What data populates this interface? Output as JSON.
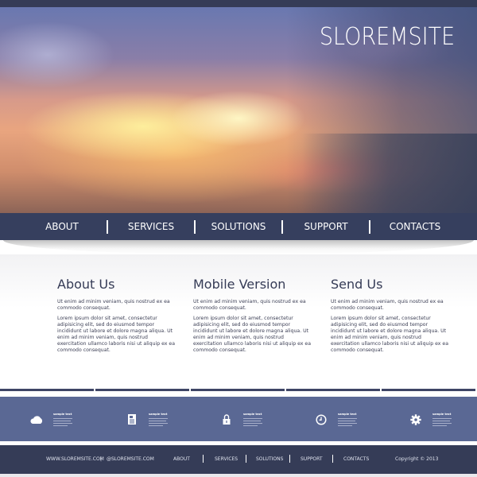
{
  "site": {
    "logo": "SLOREMSITE"
  },
  "nav": {
    "items": [
      {
        "label": "ABOUT"
      },
      {
        "label": "SERVICES"
      },
      {
        "label": "SOLUTIONS"
      },
      {
        "label": "SUPPORT"
      },
      {
        "label": "CONTACTS"
      }
    ]
  },
  "columns": [
    {
      "title": "About Us",
      "intro": "Ut enim ad minim veniam, quis nostrud ex ea commodo consequat.",
      "body": "Lorem ipsum dolor sit amet, consectetur adipisicing elit, sed do eiusmod tempor incididunt ut labore et dolore magna aliqua. Ut enim ad minim veniam, quis nostrud exercitation ullamco laboris nisi ut aliquip ex ea commodo consequat."
    },
    {
      "title": "Mobile Version",
      "intro": "Ut enim ad minim veniam, quis nostrud ex ea commodo consequat.",
      "body": "Lorem ipsum dolor sit amet, consectetur adipisicing elit, sed do eiusmod tempor incididunt ut labore et dolore magna aliqua. Ut enim ad minim veniam, quis nostrud exercitation ullamco laboris nisi ut aliquip ex ea commodo consequat."
    },
    {
      "title": "Send Us",
      "intro": "Ut enim ad minim veniam, quis nostrud ex ea commodo consequat.",
      "body": "Lorem ipsum dolor sit amet, consectetur adipisicing elit, sed do eiusmod tempor incididunt ut labore et dolore magna aliqua. Ut enim ad minim veniam, quis nostrud exercitation ullamco laboris nisi ut aliquip ex ea commodo consequat."
    }
  ],
  "features": [
    {
      "icon": "cloud-icon",
      "title": "sample text"
    },
    {
      "icon": "document-icon",
      "title": "sample text"
    },
    {
      "icon": "lock-icon",
      "title": "sample text"
    },
    {
      "icon": "clock-icon",
      "title": "sample text"
    },
    {
      "icon": "gear-icon",
      "title": "sample text"
    }
  ],
  "footer": {
    "website": "WWW.SLOREMSITE.COM",
    "separator": "|",
    "email": "@SLOREMSITE.COM",
    "links": [
      {
        "label": "ABOUT"
      },
      {
        "label": "SERVICES"
      },
      {
        "label": "SOLUTIONS"
      },
      {
        "label": "SUPPORT"
      },
      {
        "label": "CONTACTS"
      }
    ],
    "copyright": "Copyright © 2013"
  },
  "colors": {
    "nav_bg": "#363f5e",
    "features_bg": "#5a6894",
    "footer_bg": "#353c57",
    "heading_text": "#353b56"
  }
}
